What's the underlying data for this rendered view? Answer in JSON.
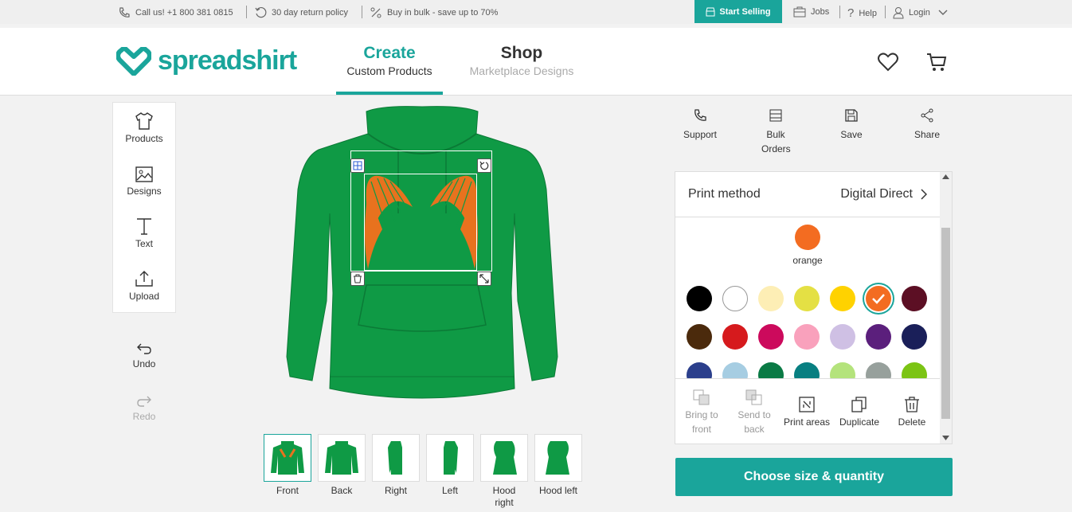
{
  "topbar": {
    "call": "Call us! +1 800 381 0815",
    "returns": "30 day return policy",
    "bulk": "Buy in bulk - save up to 70%",
    "start_selling": "Start Selling",
    "jobs": "Jobs",
    "help": "Help",
    "login": "Login"
  },
  "header": {
    "logo": "spreadshirt",
    "create_title": "Create",
    "create_sub": "Custom Products",
    "shop_title": "Shop",
    "shop_sub": "Marketplace Designs"
  },
  "tools": {
    "products": "Products",
    "designs": "Designs",
    "text": "Text",
    "upload": "Upload",
    "undo": "Undo",
    "redo": "Redo"
  },
  "views": [
    {
      "label": "Front"
    },
    {
      "label": "Back"
    },
    {
      "label": "Right"
    },
    {
      "label": "Left"
    },
    {
      "label": "Hood right"
    },
    {
      "label": "Hood left"
    }
  ],
  "actions": {
    "support": "Support",
    "bulk": "Bulk Orders",
    "save": "Save",
    "share": "Share"
  },
  "panel": {
    "print_method_label": "Print method",
    "print_method_value": "Digital Direct",
    "selected_color_name": "orange",
    "selected_color": "#f36c21",
    "colors": [
      "#000000",
      "#ffffff",
      "#fdeeb5",
      "#e4e044",
      "#ffd200",
      "#f36c21",
      "#5c0f24",
      "#4b2a0c",
      "#d61a1d",
      "#cc0a5c",
      "#f9a1bc",
      "#cfc0e4",
      "#5b1f7c",
      "#1a1f59",
      "#2b3f8c",
      "#a6cde2",
      "#0a7a45",
      "#087f81",
      "#b4e37c",
      "#97a09c",
      "#7bc414"
    ],
    "bring_front": "Bring to front",
    "send_back": "Send to back",
    "print_areas": "Print areas",
    "duplicate": "Duplicate",
    "delete": "Delete"
  },
  "choose_button": "Choose size & quantity",
  "colors": {
    "brand": "#1aa59b",
    "hoodie": "#0f9a45",
    "wings": "#e8721e"
  }
}
